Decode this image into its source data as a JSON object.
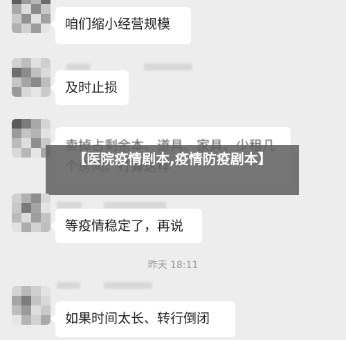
{
  "messages": [
    {
      "text": "咱们缩小经营规模"
    },
    {
      "text": "及时止损"
    },
    {
      "text": "卖掉占剩余本、道具、家具、少租几个房间。打算这样"
    },
    {
      "text": "等疫情稳定了，再说"
    },
    {
      "text": "如果时间太长、转行倒闭"
    }
  ],
  "timestamp": "昨天 18:11",
  "banner": "【医院疫情剧本,疫情防疫剧本】",
  "colors": {
    "background": "#ededed",
    "bubble": "#ffffff",
    "banner": "#5f5f5f"
  }
}
